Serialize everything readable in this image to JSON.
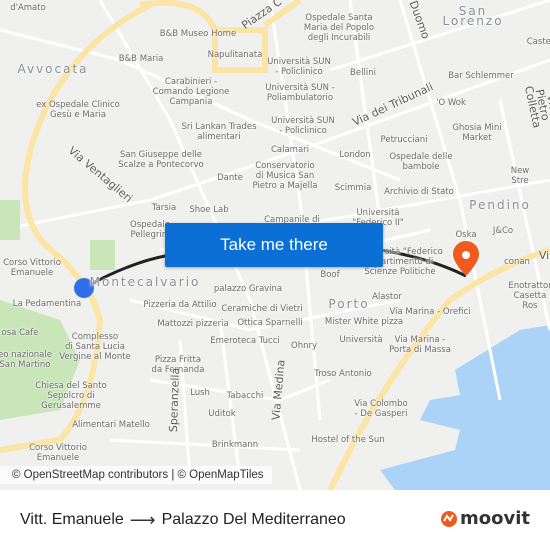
{
  "map": {
    "labels": [
      "d'Amato",
      "B&B Museo Home",
      "B&B Maria",
      "Napulitanata",
      "Carabinieri -\nComando Legione\nCampania",
      "ex Ospedale Clinico\nGesù e Maria",
      "Sri Lankan Trades\nalimentari",
      "San Giuseppe delle\nScalze a Pontecorvo",
      "Dante",
      "Tarsia",
      "Shoe Lab",
      "Ospedale\nPellegrini",
      "Ospedale Santa\nMaria del Popolo\ndegli Incurabili",
      "Castel",
      "Università SUN\n- Policlinico",
      "Bellini",
      "Università SUN -\nPoliambulatorio",
      "Bar Schlemmer",
      "'O Wok",
      "Università SUN\n- Policlinico",
      "Ghosia Mini Market",
      "Petrucciani",
      "Calamari",
      "London",
      "Conservatorio\ndi Musica San\nPietro a Majella",
      "Ospedale delle\nbambole",
      "New Stre",
      "Scimmia",
      "Archivio di Stato",
      "Università\n\"Federico II\"",
      "Campanile di",
      "Oska",
      "J&Co",
      "Corso Vittorio\nEmanuele",
      "La Pedamentina",
      "palazzo Gravina",
      "Pizzeria da Attilio",
      "Ceramiche di Vietri",
      "Mattozzi pizzeria",
      "Ottica Sparnelli",
      "osa Cafe",
      "Complesso\ndi Santa Lucia\nVergine al Monte",
      "Emeroteca Tucci",
      "eo nazionale\nSan Martino",
      "Pizza Fritta\nda Fernanda",
      "Chiesa del Santo\nSepolcro di\nGerusalemme",
      "Lush",
      "Tabacchi",
      "Uditok",
      "Alimentari Matello",
      "Brinkmann",
      "Corso Vittorio\nEmanuele",
      "Boof",
      "Alastor",
      "Università \"Federico\nDipartimento di\nScienze Politiche",
      "conan",
      "Enotrattor\nCasetta Ros",
      "Via Marina - Orefici",
      "Mister White pizza",
      "Università",
      "Ohnry",
      "Via Marina -\nPorta di Massa",
      "Troso Antonio",
      "Via Colombo\n- De Gasperi",
      "Hostel of the Sun"
    ],
    "districts": [
      "Avvocata",
      "San Lorenzo",
      "Pendino",
      "Montecalvario",
      "Porto"
    ],
    "streets": [
      "Via Ventaglieri",
      "Piazza C",
      "Duomo",
      "Via dei Tribunali",
      "Via Pietro Colletta",
      "Speranzella",
      "Via Medina",
      "Vi"
    ],
    "button": "Take me there",
    "attribution": "© OpenStreetMap contributors | © OpenMapTiles",
    "colors": {
      "button": "#0b6fd6",
      "origin": "#2f6fe8",
      "destination": "#f05a1e",
      "water": "#aad3f7",
      "major_road": "#fbe5a4"
    }
  },
  "footer": {
    "origin": "Vitt. Emanuele",
    "arrow": "⟶",
    "destination": "Palazzo Del Mediterraneo",
    "logo": "moovit"
  }
}
